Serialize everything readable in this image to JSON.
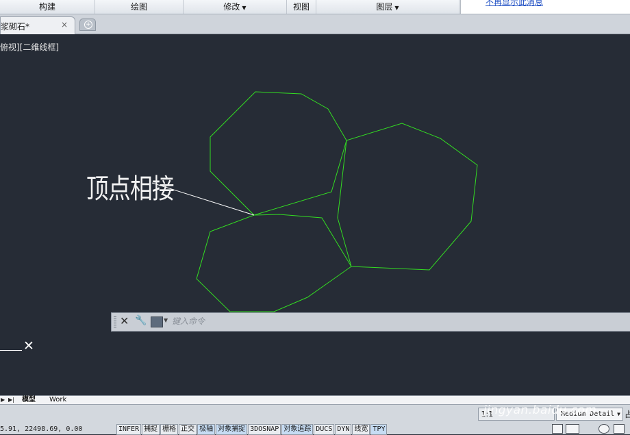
{
  "ribbon": {
    "panels": [
      {
        "label": "构建",
        "dropdown": false
      },
      {
        "label": "绘图",
        "dropdown": false
      },
      {
        "label": "修改",
        "dropdown": true
      },
      {
        "label": "视图",
        "dropdown": false
      },
      {
        "label": "图层",
        "dropdown": true
      }
    ],
    "notice_link": "不再显示此消息"
  },
  "tabs": {
    "document_tab": "浆砌石*",
    "close_glyph": "×",
    "new_tab_glyph": "+"
  },
  "viewport": {
    "view_label": "俯视][二维线框]",
    "annotation": "顶点相接",
    "line_color": "#33dd22",
    "annotation_color": "#ffffff"
  },
  "command_line": {
    "placeholder": "键入命令",
    "close_glyph": "✕",
    "wrench_glyph": "🔧"
  },
  "ucs": {
    "x_mark": "✕"
  },
  "layout_tabs": {
    "nav_first": "▶",
    "nav_last": "▶|",
    "tabs": [
      "模型",
      "Work"
    ]
  },
  "status_bar": {
    "coordinates": "5.91, 22498.69, 0.00",
    "toggles": [
      {
        "label": "INFER",
        "on": false
      },
      {
        "label": "捕捉",
        "on": false
      },
      {
        "label": "栅格",
        "on": false
      },
      {
        "label": "正交",
        "on": false
      },
      {
        "label": "极轴",
        "on": true
      },
      {
        "label": "对象捕捉",
        "on": true
      },
      {
        "label": "3DOSNAP",
        "on": false
      },
      {
        "label": "对象追踪",
        "on": true
      },
      {
        "label": "DUCS",
        "on": false
      },
      {
        "label": "DYN",
        "on": false
      },
      {
        "label": "线宽",
        "on": false
      },
      {
        "label": "TPY",
        "on": true
      }
    ],
    "scale": "1:1",
    "detail_level": "Medium Detail",
    "tray_text": "占"
  },
  "watermark": "jingyan.baidu.com"
}
